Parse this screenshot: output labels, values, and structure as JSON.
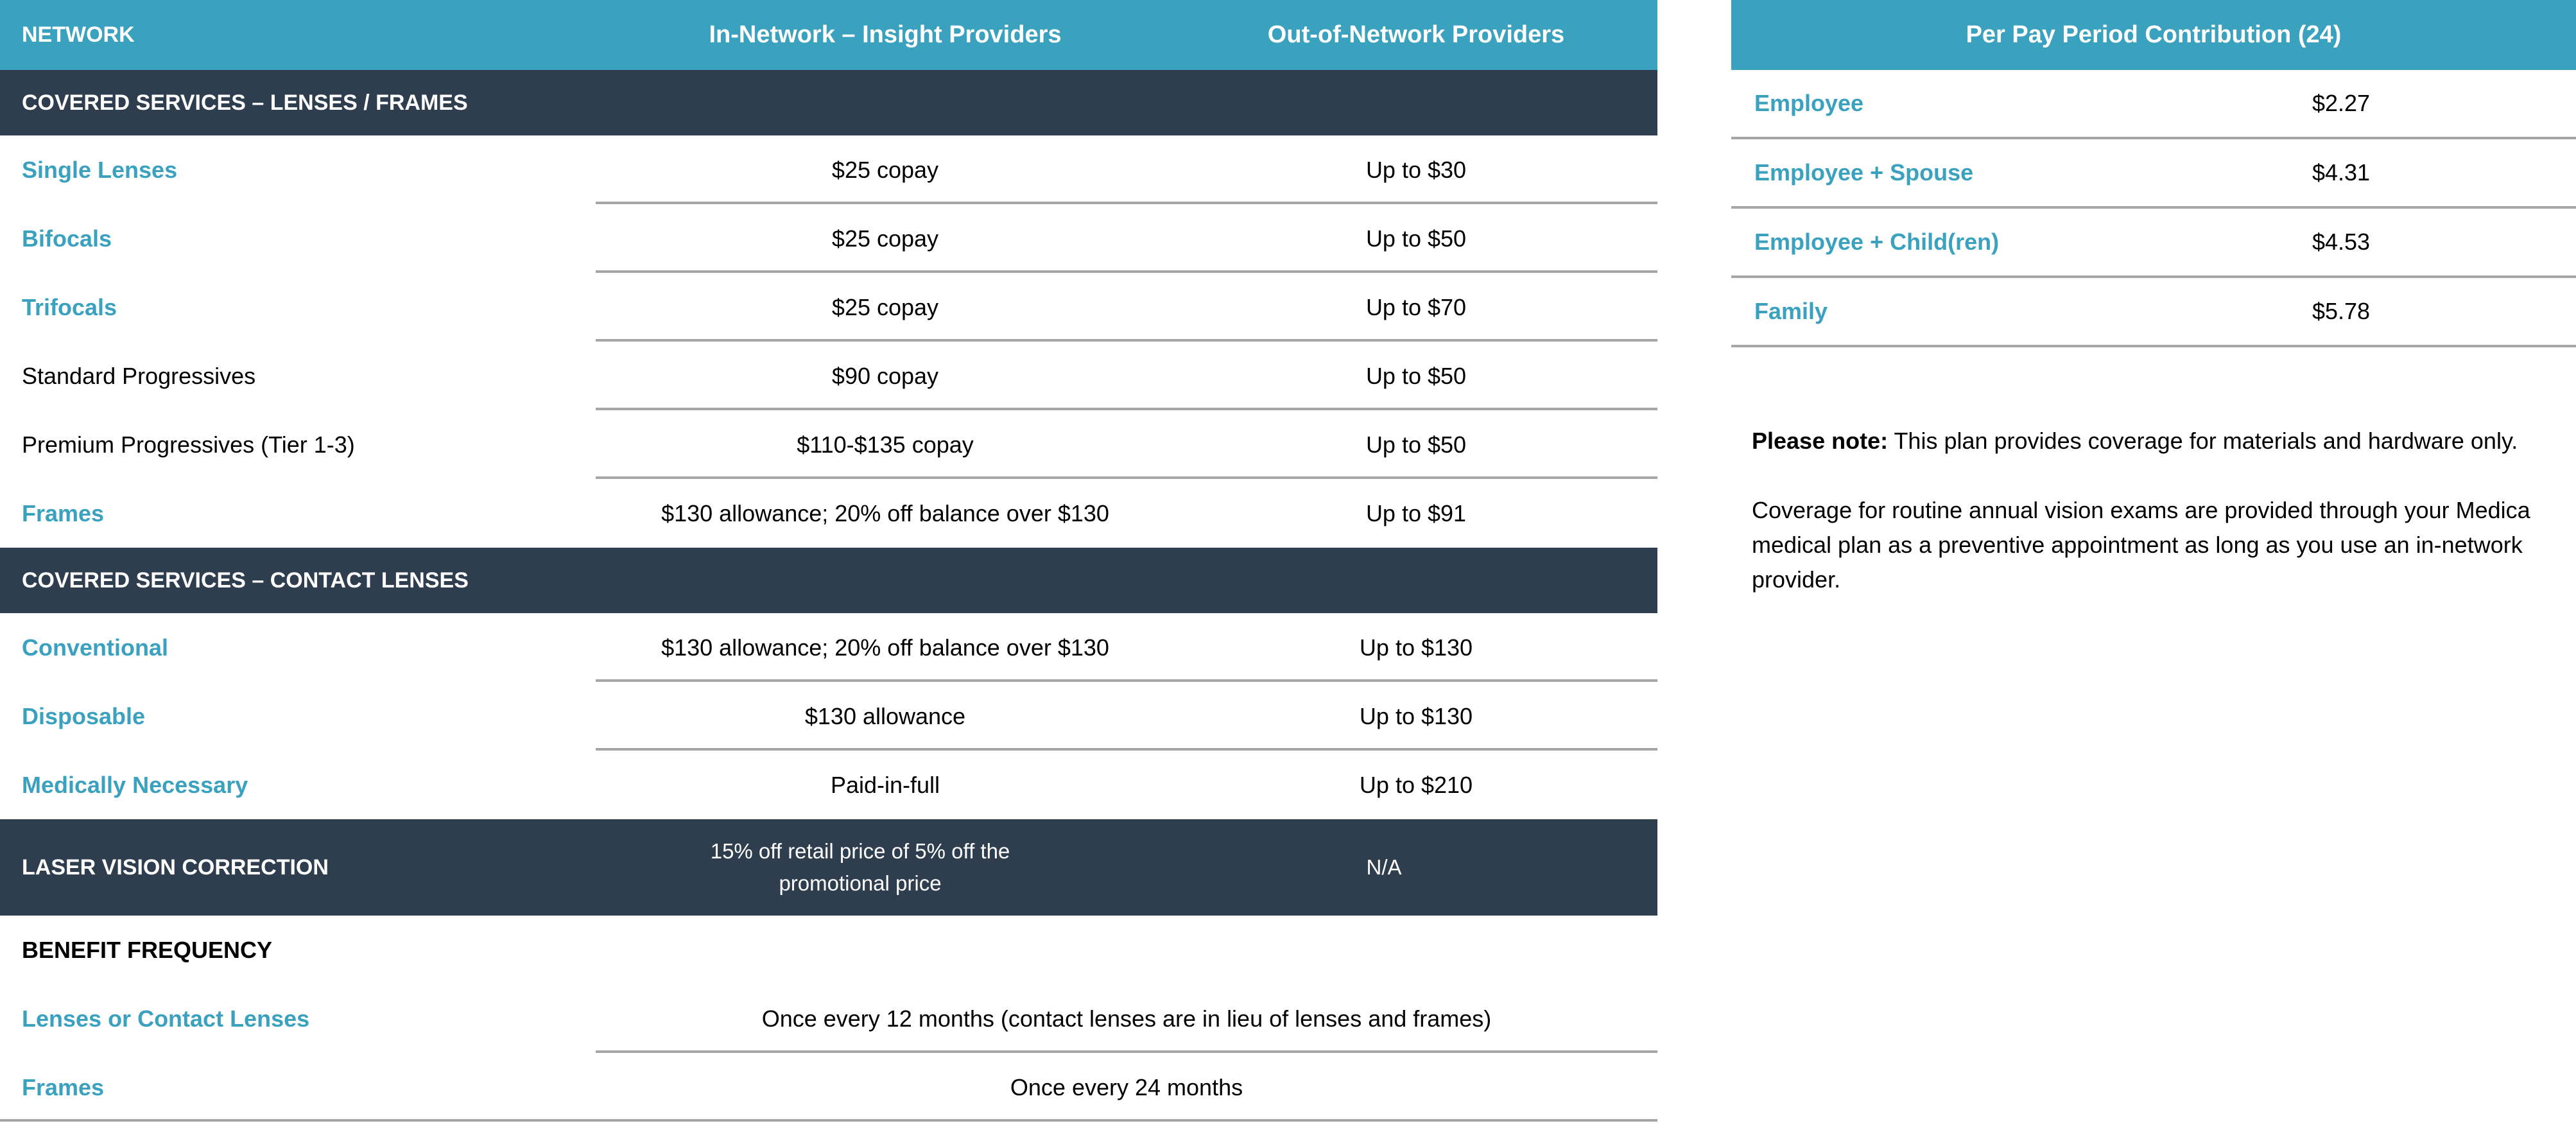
{
  "benefits_table": {
    "headers": {
      "network": "NETWORK",
      "in_network": "In-Network – Insight Providers",
      "out_of_network": "Out-of-Network Providers"
    },
    "sections": [
      {
        "title": "COVERED SERVICES – LENSES / FRAMES",
        "rows": [
          {
            "label": "Single Lenses",
            "in_network": "$25 copay",
            "out_of_network": "Up to $30",
            "highlight": true
          },
          {
            "label": "Bifocals",
            "in_network": "$25 copay",
            "out_of_network": "Up to $50",
            "highlight": true
          },
          {
            "label": "Trifocals",
            "in_network": "$25 copay",
            "out_of_network": "Up to $70",
            "highlight": true
          },
          {
            "label": "Standard Progressives",
            "in_network": "$90 copay",
            "out_of_network": "Up to $50",
            "highlight": false
          },
          {
            "label": "Premium Progressives (Tier 1-3)",
            "in_network": "$110-$135 copay",
            "out_of_network": "Up to $50",
            "highlight": false
          },
          {
            "label": "Frames",
            "in_network": "$130 allowance; 20% off balance over $130",
            "out_of_network": "Up to $91",
            "highlight": true
          }
        ]
      },
      {
        "title": "COVERED SERVICES – CONTACT LENSES",
        "rows": [
          {
            "label": "Conventional",
            "in_network": "$130 allowance; 20% off balance over $130",
            "out_of_network": "Up to $130",
            "highlight": true
          },
          {
            "label": "Disposable",
            "in_network": "$130 allowance",
            "out_of_network": "Up to $130",
            "highlight": true
          },
          {
            "label": "Medically Necessary",
            "in_network": "Paid-in-full",
            "out_of_network": "Up to $210",
            "highlight": true
          }
        ]
      }
    ],
    "laser": {
      "label": "LASER VISION CORRECTION",
      "in_network": "15% off retail price of 5% off the promotional price",
      "out_of_network": "N/A"
    },
    "frequency": {
      "title": "BENEFIT FREQUENCY",
      "rows": [
        {
          "label": "Lenses or Contact Lenses",
          "value": "Once every 12 months (contact lenses are in lieu of lenses and frames)"
        },
        {
          "label": "Frames",
          "value": "Once every 24 months"
        }
      ]
    }
  },
  "contribution_table": {
    "title": "Per Pay Period Contribution (24)",
    "rows": [
      {
        "tier": "Employee",
        "amount": "$2.27"
      },
      {
        "tier": "Employee + Spouse",
        "amount": "$4.31"
      },
      {
        "tier": "Employee + Child(ren)",
        "amount": "$4.53"
      },
      {
        "tier": "Family",
        "amount": "$5.78"
      }
    ]
  },
  "note": {
    "lead": "Please note:",
    "text": " This plan provides coverage for materials and hardware only.",
    "paragraph2": "Coverage for routine annual vision exams are provided through your Medica medical plan as a preventive appointment as long as you use an in-network provider."
  },
  "colors": {
    "header_teal": "#3aa1bf",
    "section_dark": "#2e3e4f",
    "rule_gray": "#a6a6a6"
  }
}
